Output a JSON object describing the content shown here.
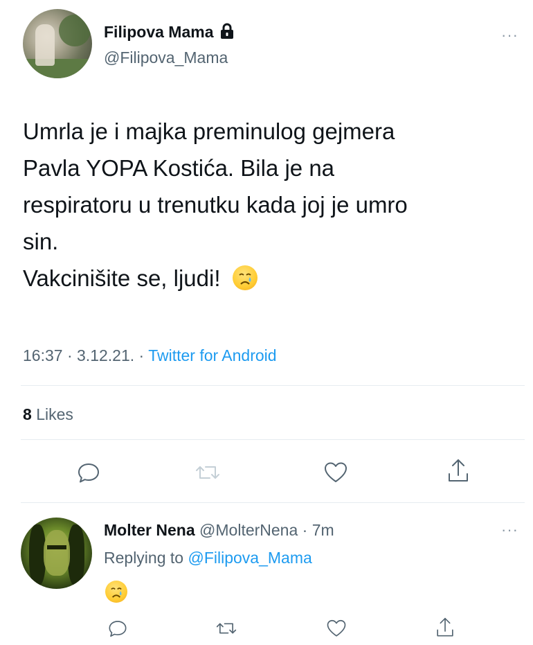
{
  "tweet": {
    "author_name": "Filipova Mama",
    "author_handle": "@Filipova_Mama",
    "more_label": "···",
    "lines": [
      "Umrla je i majka preminulog gejmera",
      "Pavla YOPA Kostića. Bila je na",
      "respiratoru u trenutku kada joj je umro",
      "sin.",
      "Vakcinišite se, ljudi!"
    ],
    "time": "16:37",
    "date": "3.12.21.",
    "separator": "·",
    "source": "Twitter for Android",
    "likes_count": "8",
    "likes_label": "Likes"
  },
  "icons": {
    "lock": "lock-icon",
    "reply": "reply-icon",
    "retweet": "retweet-icon",
    "like": "like-icon",
    "share": "share-icon",
    "emoji": "crying-face-emoji"
  },
  "reply": {
    "author_name": "Molter Nena",
    "author_handle": "@MolterNena",
    "time_ago": "7m",
    "separator": "·",
    "replying_prefix": "Replying to",
    "replying_handle": "@Filipova_Mama",
    "more_label": "···"
  },
  "colors": {
    "link": "#1d9bf0",
    "secondary_text": "#536471",
    "retweet_disabled": "#c4cfd6"
  }
}
